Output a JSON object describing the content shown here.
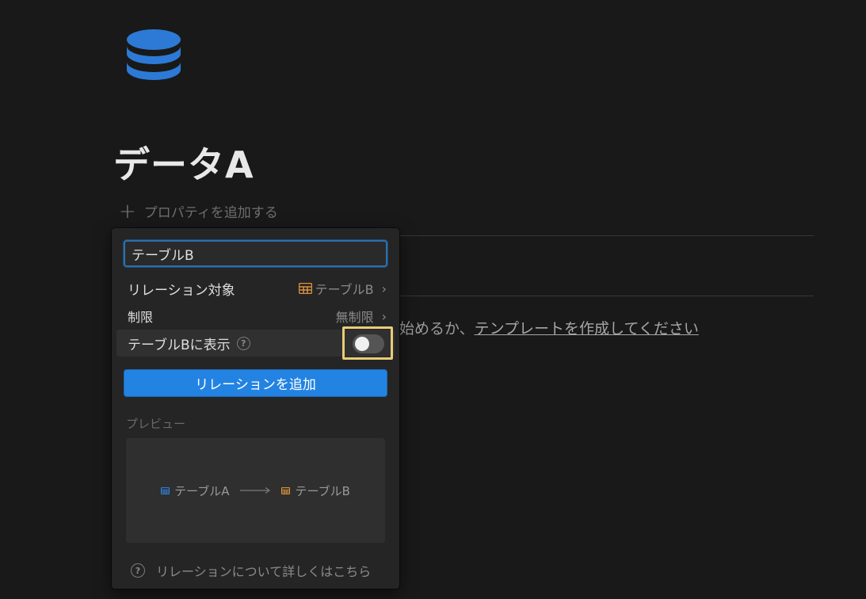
{
  "page": {
    "title": "データA",
    "add_property_label": "プロパティを追加する",
    "empty_text_prefix": "始めるか、",
    "empty_text_link": "テンプレートを作成してください",
    "icon": "database-icon"
  },
  "relation_panel": {
    "name_input_value": "テーブルB",
    "relation_target_label": "リレーション対象",
    "relation_target_value": "テーブルB",
    "limit_label": "制限",
    "limit_value": "無制限",
    "show_in_label": "テーブルBに表示",
    "show_in_toggle": false,
    "add_button_label": "リレーションを追加",
    "preview_label": "プレビュー",
    "preview_from": "テーブルA",
    "preview_to": "テーブルB",
    "learn_more_label": "リレーションについて詳しくはこちら"
  },
  "colors": {
    "accent": "#2383e2",
    "table_a_icon": "#2f7fd6",
    "table_b_icon": "#d9923a",
    "highlight": "#e8cc78"
  }
}
